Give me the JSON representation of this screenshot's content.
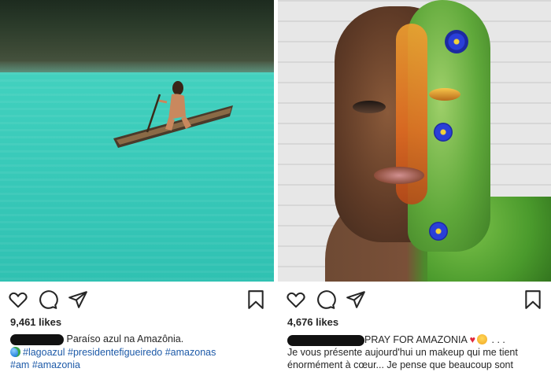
{
  "posts": [
    {
      "photo_alt": "",
      "likes": "9,461 likes",
      "caption_text": "Paraíso azul na Amazônia.",
      "hashtags_line1": [
        "#lagoazul",
        "#presidentefigueiredo",
        "#amazonas"
      ],
      "hashtags_line2": [
        "#am",
        "#amazonia"
      ]
    },
    {
      "photo_alt": "",
      "likes": "4,676 likes",
      "caption_text": "PRAY FOR AMAZONIA",
      "caption_suffix": ". . .",
      "caption_line2": "Je vous présente aujourd'hui un makeup qui me tient",
      "caption_line3": "énormément à cœur... Je pense que beaucoup sont"
    }
  ],
  "icons": {
    "like": "heart-icon",
    "comment": "comment-icon",
    "share": "share-icon",
    "save": "bookmark-icon",
    "globe": "globe-emoji",
    "heart": "red-heart-emoji",
    "face": "pouting-face-emoji"
  },
  "colors": {
    "text": "#262626",
    "hashtag": "#1d5aa8",
    "redaction": "#111111",
    "lake": "#3fcfbd"
  }
}
